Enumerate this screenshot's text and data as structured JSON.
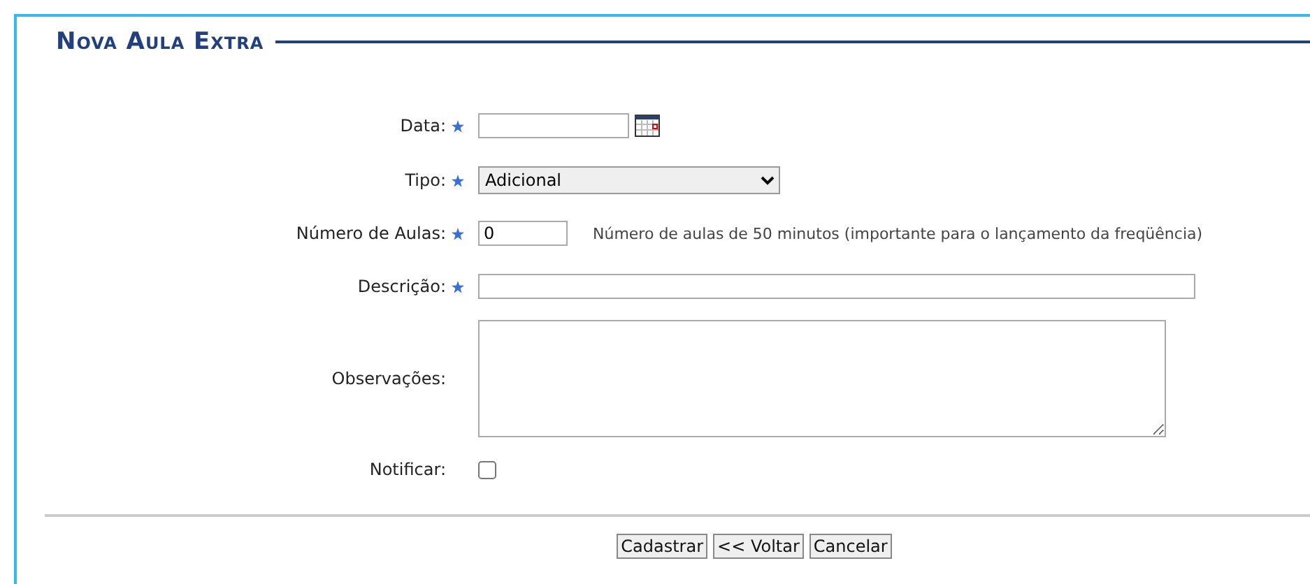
{
  "title": "Nova Aula Extra",
  "fields": [
    {
      "kind": "date",
      "label": "Data:",
      "required": true
    },
    {
      "kind": "select",
      "label": "Tipo:",
      "required": true,
      "value": "Adicional"
    },
    {
      "kind": "number",
      "label": "Número de Aulas:",
      "required": true,
      "value": "0",
      "hint": "Número de aulas de 50 minutos (importante para o lançamento da freqüência)"
    },
    {
      "kind": "text",
      "label": "Descrição:",
      "required": true
    },
    {
      "kind": "textarea",
      "label": "Observações:",
      "required": false
    },
    {
      "kind": "checkbox",
      "label": "Notificar:",
      "required": false,
      "checked": false
    }
  ],
  "buttons": [
    "Cadastrar",
    "<< Voltar",
    "Cancelar"
  ]
}
